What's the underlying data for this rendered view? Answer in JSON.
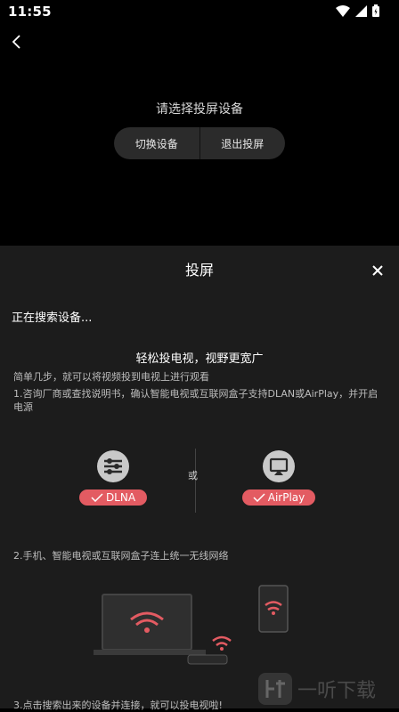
{
  "status": {
    "time": "11:55"
  },
  "top": {
    "prompt": "请选择投屏设备",
    "switch_label": "切换设备",
    "exit_label": "退出投屏"
  },
  "sheet": {
    "title": "投屏",
    "searching": "正在搜索设备...",
    "tagline": "轻松投电视，视野更宽广",
    "intro": "简单几步，就可以将视频投到电视上进行观看",
    "step1": "1.咨询厂商或查找说明书，确认智能电视或互联网盒子支持DLAN或AirPlay，并开启电源",
    "separator": "或",
    "dlna_label": "DLNA",
    "airplay_label": "AirPlay",
    "step2": "2.手机、智能电视或互联网盒子连上统一无线网络",
    "step3": "3.点击搜索出来的设备并连接，就可以投电视啦!"
  },
  "watermark": {
    "text": "一听下载"
  },
  "colors": {
    "accent": "#e35b62",
    "sheet_bg": "#1c1c1c",
    "top_bg": "#000000"
  },
  "icons": [
    "back-arrow-icon",
    "close-icon",
    "wifi-icon",
    "signal-icon",
    "battery-icon",
    "dlna-icon",
    "airplay-icon",
    "check-icon"
  ]
}
